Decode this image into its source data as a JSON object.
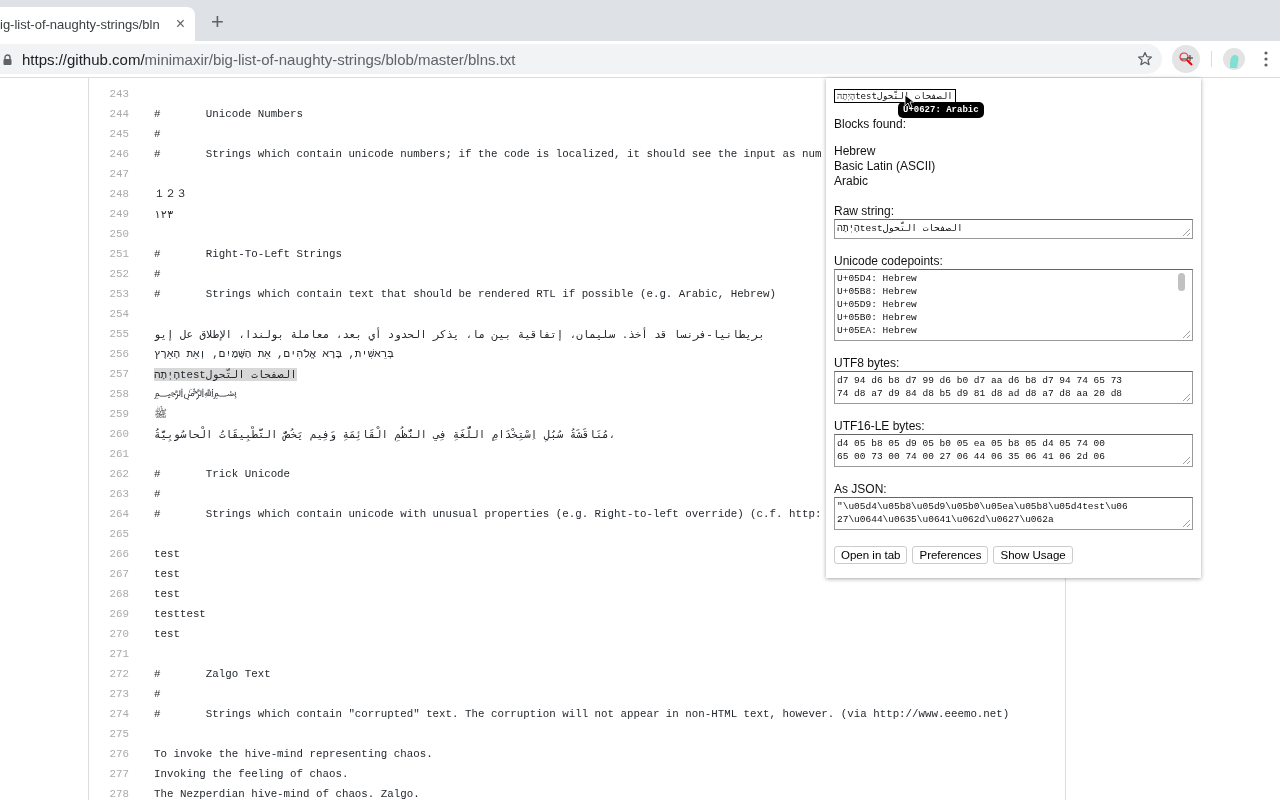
{
  "browser": {
    "tab": {
      "title": "ig-list-of-naughty-strings/bln",
      "close": "×"
    },
    "new_tab": "+",
    "address": {
      "host": "https://github.com/",
      "path": "minimaxir/big-list-of-naughty-strings/blob/master/blns.txt"
    }
  },
  "code": {
    "lines": [
      {
        "number": "243",
        "selected": false
      },
      {
        "number": "244",
        "text": "#\tUnicode Numbers",
        "selected": false
      },
      {
        "number": "245",
        "text": "#",
        "selected": false
      },
      {
        "number": "246",
        "text": "#\tStrings which contain unicode numbers; if the code is localized, it should see the input as num",
        "selected": false
      },
      {
        "number": "247",
        "selected": false
      },
      {
        "number": "248",
        "text": "１２３",
        "selected": false
      },
      {
        "number": "249",
        "text": "١٢٣",
        "selected": false
      },
      {
        "number": "250",
        "selected": false
      },
      {
        "number": "251",
        "text": "#\tRight-To-Left Strings",
        "selected": false
      },
      {
        "number": "252",
        "text": "#",
        "selected": false
      },
      {
        "number": "253",
        "text": "#\tStrings which contain text that should be rendered RTL if possible (e.g. Arabic, Hebrew)",
        "selected": false
      },
      {
        "number": "254",
        "selected": false
      },
      {
        "number": "255",
        "text": "بريطانيا-فرنسا قد أخذ. سليمان، إتفاقية بين ما، يذكر الحدود أي بعد، معاملة بولندا، الإطلاق عل إيو",
        "selected": false
      },
      {
        "number": "256",
        "text": "בְּרֵאשִׁית, בָּרָא אֱלֹהִים, אֵת הַשָּׁמַיִם, וְאֵת הָאָרֶץ",
        "selected": false
      },
      {
        "number": "257",
        "text": "הָיְתָהtestالصفحات التّحول",
        "selected": true
      },
      {
        "number": "258",
        "text": "﷽",
        "selected": false
      },
      {
        "number": "259",
        "text": "ﷺ",
        "selected": false
      },
      {
        "number": "260",
        "text": "مُنَاقَشَةُ سُبُلِ اِسْتِخْدَامِ اللُّغَةِ فِي النُّظُمِ الْقَائِمَةِ وَفِيم يَخُصُّ التَّطْبِيقَاتُ الْحاسُوبِيَّةُ،",
        "selected": false
      },
      {
        "number": "261",
        "selected": false
      },
      {
        "number": "262",
        "text": "#\tTrick Unicode",
        "selected": false
      },
      {
        "number": "263",
        "text": "#",
        "selected": false
      },
      {
        "number": "264",
        "text": "#\tStrings which contain unicode with unusual properties (e.g. Right-to-left override) (c.f. http:",
        "selected": false
      },
      {
        "number": "265",
        "selected": false
      },
      {
        "number": "266",
        "text": "test",
        "selected": false
      },
      {
        "number": "267",
        "text": "test",
        "selected": false
      },
      {
        "number": "268",
        "text": "test",
        "selected": false
      },
      {
        "number": "269",
        "text": "testtest",
        "selected": false
      },
      {
        "number": "270",
        "text": "test",
        "selected": false
      },
      {
        "number": "271",
        "selected": false
      },
      {
        "number": "272",
        "text": "#\tZalgo Text",
        "selected": false
      },
      {
        "number": "273",
        "text": "#",
        "selected": false
      },
      {
        "number": "274",
        "text": "#\tStrings which contain \"corrupted\" text. The corruption will not appear in non-HTML text, however. (via http://www.eeemo.net)",
        "selected": false
      },
      {
        "number": "275",
        "selected": false
      },
      {
        "number": "276",
        "text": "To invoke the hive-mind representing chaos.",
        "selected": false
      },
      {
        "number": "277",
        "text": "Invoking the feeling of chaos.",
        "selected": false
      },
      {
        "number": "278",
        "text": "The Nezperdian hive-mind of chaos. Zalgo.",
        "selected": false
      }
    ]
  },
  "popup": {
    "input": "הָיְתָהtestالصفحات التّحول",
    "tooltip": "U+0627: Arabic",
    "blocks_label": "Blocks found:",
    "blocks": [
      "Hebrew",
      "Basic Latin (ASCII)",
      "Arabic"
    ],
    "fields": [
      {
        "label": "Raw string:",
        "lines": [
          "הָיְתָהtestالصفحات التّحول"
        ],
        "scrollbar": false
      },
      {
        "label": "Unicode codepoints:",
        "lines": [
          "U+05D4: Hebrew",
          "U+05B8: Hebrew",
          "U+05D9: Hebrew",
          "U+05B0: Hebrew",
          "U+05EA: Hebrew"
        ],
        "scrollbar": true
      },
      {
        "label": "UTF8 bytes:",
        "lines": [
          "d7 94 d6 b8 d7 99 d6 b0 d7 aa d6 b8 d7 94 74 65 73",
          "74 d8 a7 d9 84 d8 b5 d9 81 d8 ad d8 a7 d8 aa 20 d8"
        ],
        "scrollbar": false
      },
      {
        "label": "UTF16-LE bytes:",
        "lines": [
          "d4 05 b8 05 d9 05 b0 05 ea 05 b8 05 d4 05 74 00",
          "65 00 73 00 74 00 27 06 44 06 35 06 41 06 2d 06"
        ],
        "scrollbar": false
      },
      {
        "label": "As JSON:",
        "lines": [
          "\"\\u05d4\\u05b8\\u05d9\\u05b0\\u05ea\\u05b8\\u05d4test\\u06",
          "27\\u0644\\u0635\\u0641\\u062d\\u0627\\u062a"
        ],
        "scrollbar": false
      }
    ],
    "buttons": [
      "Open in tab",
      "Preferences",
      "Show Usage"
    ]
  }
}
